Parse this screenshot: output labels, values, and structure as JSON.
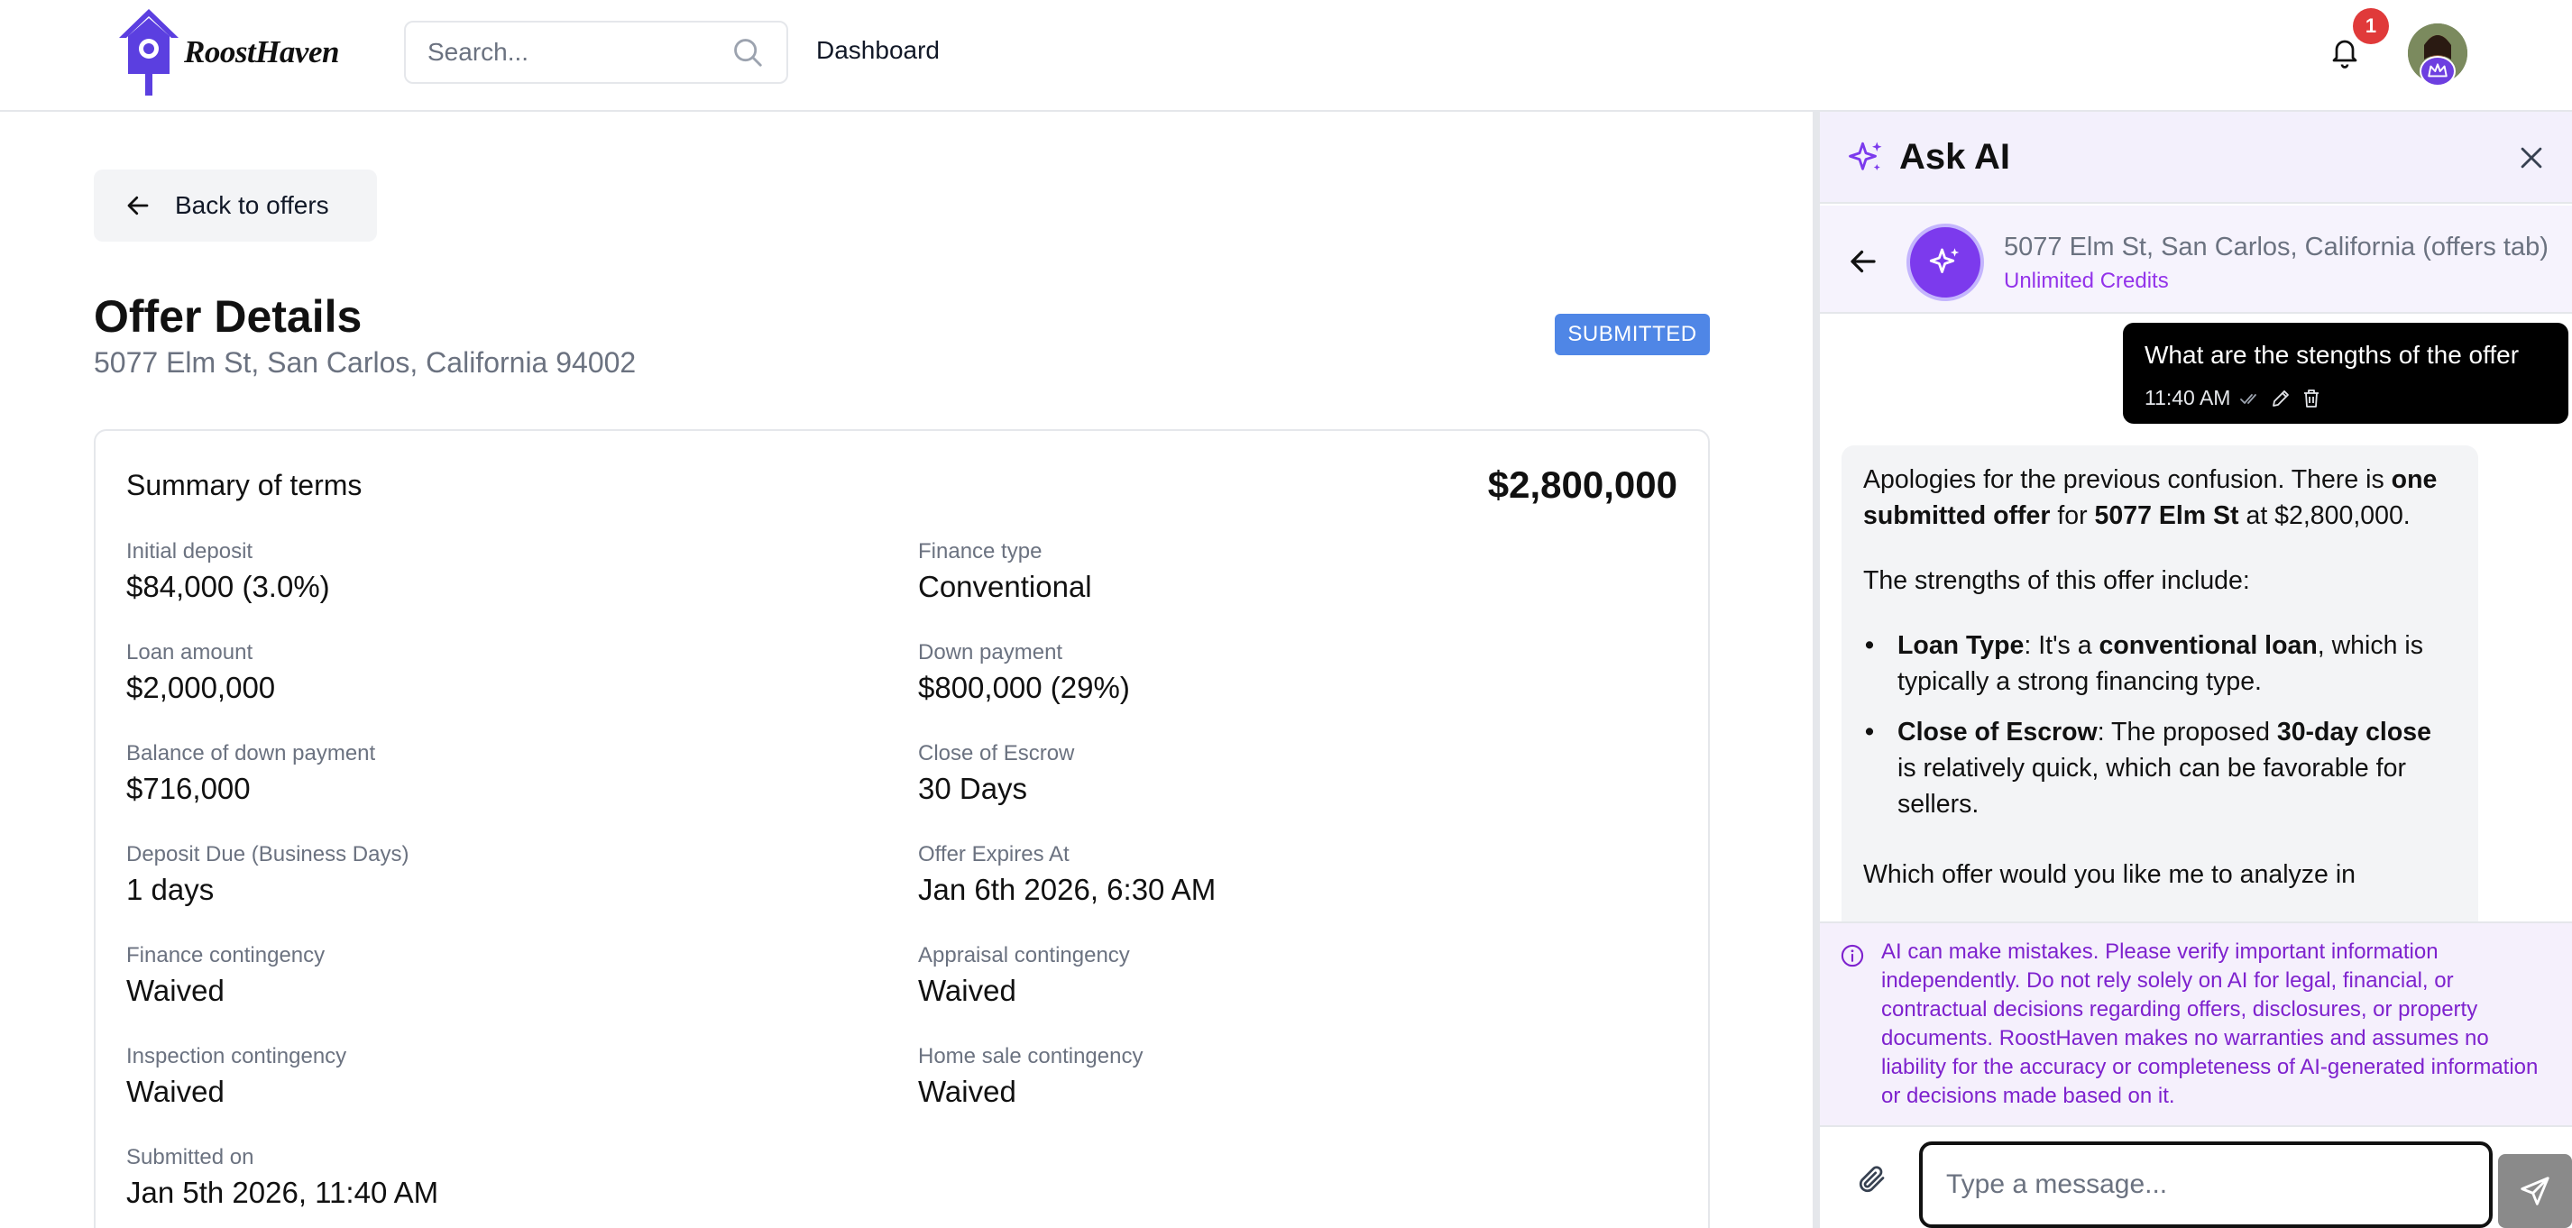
{
  "app": {
    "brand": "RoostHaven",
    "search_placeholder": "Search...",
    "nav_dashboard": "Dashboard",
    "notification_count": "1"
  },
  "main": {
    "back_label": "Back to offers",
    "title": "Offer Details",
    "address": "5077 Elm St, San Carlos, California 94002",
    "status": "SUBMITTED",
    "summary_title": "Summary of terms",
    "price": "$2,800,000",
    "terms_left": [
      {
        "label": "Initial deposit",
        "value": "$84,000 (3.0%)"
      },
      {
        "label": "Loan amount",
        "value": "$2,000,000"
      },
      {
        "label": "Balance of down payment",
        "value": "$716,000"
      },
      {
        "label": "Deposit Due (Business Days)",
        "value": "1 days"
      },
      {
        "label": "Finance contingency",
        "value": "Waived"
      },
      {
        "label": "Inspection contingency",
        "value": "Waived"
      },
      {
        "label": "Submitted on",
        "value": "Jan 5th 2026, 11:40 AM"
      }
    ],
    "terms_right": [
      {
        "label": "Finance type",
        "value": "Conventional"
      },
      {
        "label": "Down payment",
        "value": "$800,000 (29%)"
      },
      {
        "label": "Close of Escrow",
        "value": "30 Days"
      },
      {
        "label": "Offer Expires At",
        "value": "Jan 6th 2026, 6:30 AM"
      },
      {
        "label": "Appraisal contingency",
        "value": "Waived"
      },
      {
        "label": "Home sale contingency",
        "value": "Waived"
      }
    ]
  },
  "ai": {
    "title": "Ask AI",
    "context_title": "5077 Elm St, San Carlos, California (offers tab)",
    "context_sub": "Unlimited Credits",
    "user_message": "What are the stengths of the offer",
    "user_time": "11:40 AM",
    "reply": {
      "p1_a": "Apologies for the previous confusion. There is ",
      "p1_b": "one submitted offer",
      "p1_c": " for ",
      "p1_d": "5077 Elm St",
      "p1_e": " at $2,800,000.",
      "p2": "The strengths of this offer include:",
      "b1_a": "Loan Type",
      "b1_b": ": It's a ",
      "b1_c": "conventional loan",
      "b1_d": ", which is typically a strong financing type.",
      "b2_a": "Close of Escrow",
      "b2_b": ": The proposed ",
      "b2_c": "30-day close",
      "b2_d": " is relatively quick, which can be favorable for sellers.",
      "p3": "Which offer would you like me to analyze in"
    },
    "disclaimer": "AI can make mistakes. Please verify important information independently. Do not rely solely on AI for legal, financial, or contractual decisions regarding offers, disclosures, or property documents. RoostHaven makes no warranties and assumes no liability for the accuracy or completeness of AI-generated information or decisions made based on it.",
    "input_placeholder": "Type a message..."
  }
}
